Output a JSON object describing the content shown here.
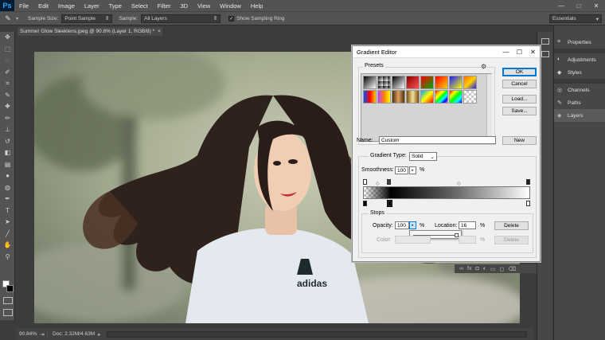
{
  "app": {
    "logo": "Ps"
  },
  "menu": [
    "File",
    "Edit",
    "Image",
    "Layer",
    "Type",
    "Select",
    "Filter",
    "3D",
    "View",
    "Window",
    "Help"
  ],
  "window_controls": [
    "—",
    "□",
    "✕"
  ],
  "options": {
    "sample_size_label": "Sample Size:",
    "sample_size_value": "Point Sample",
    "sample_label": "Sample:",
    "sample_value": "All Layers",
    "show_ring_checked": "✓",
    "show_ring_label": "Show Sampling Ring",
    "workspace": "Essentials"
  },
  "document_tab": {
    "title": "Summer Glow Sleeklens.jpeg @ 90.8% (Layer 1, RGB/8) *",
    "close": "×"
  },
  "status": {
    "zoom": "90.84%",
    "doc": "Doc: 2.32M/4.63M"
  },
  "panels": [
    {
      "icon": "≡",
      "label": "Properties"
    },
    {
      "icon": "◐",
      "label": "Adjustments"
    },
    {
      "icon": "◆",
      "label": "Styles"
    },
    {
      "icon": "◎",
      "label": "Channels"
    },
    {
      "icon": "✎",
      "label": "Paths"
    },
    {
      "icon": "◈",
      "label": "Layers"
    }
  ],
  "gradient_editor": {
    "title": "Gradient Editor",
    "presets_label": "Presets",
    "buttons": {
      "ok": "OK",
      "cancel": "Cancel",
      "load": "Load...",
      "save": "Save...",
      "new": "New"
    },
    "name_label": "Name:",
    "name_value": "Custom",
    "gradient_type_label": "Gradient Type:",
    "gradient_type_value": "Solid",
    "smoothness_label": "Smoothness:",
    "smoothness_value": "100",
    "percent": "%",
    "stops_label": "Stops",
    "opacity_label": "Opacity:",
    "opacity_value": "100",
    "location_label": "Location:",
    "location_value": "16",
    "color_label": "Color:",
    "delete": "Delete"
  }
}
